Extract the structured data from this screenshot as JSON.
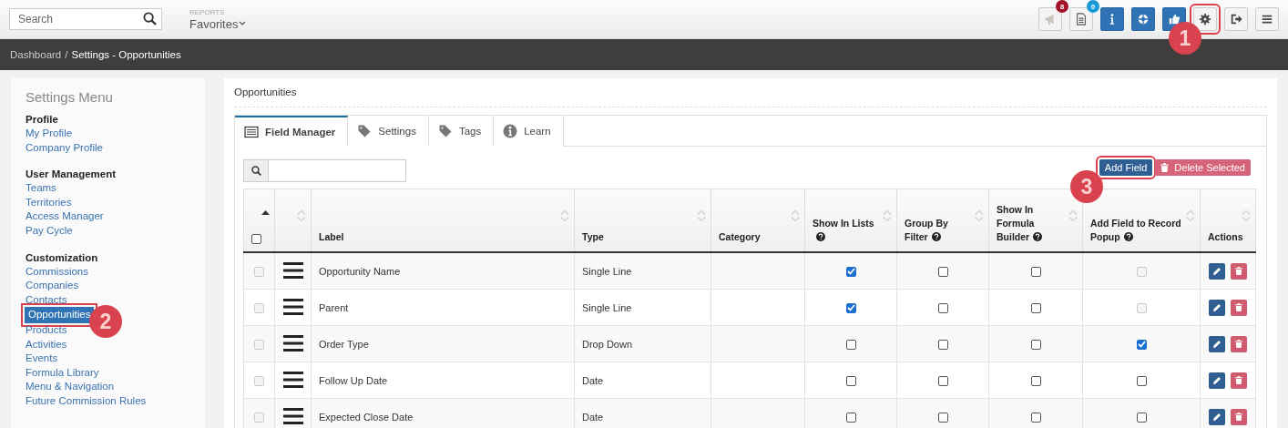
{
  "top_bar": {
    "search": {
      "placeholder": "Search"
    },
    "reports_label": "REPORTS",
    "favorites": "Favorites",
    "toolbar": [
      {
        "kind": "default",
        "badge": {
          "text": "8",
          "color": "#a3142c"
        }
      },
      {
        "kind": "default",
        "badge": {
          "text": "0",
          "color": "#1a9bd7"
        }
      },
      {
        "kind": "primary"
      },
      {
        "kind": "primary"
      },
      {
        "kind": "primary"
      },
      {
        "kind": "default",
        "callout": "1"
      },
      {
        "kind": "default"
      },
      {
        "kind": "default"
      }
    ]
  },
  "breadcrumb": {
    "separator": "/",
    "items": [
      {
        "label": "Dashboard",
        "current": false
      },
      {
        "label": "Settings - Opportunities",
        "current": true
      }
    ]
  },
  "sidebar": {
    "title": "Settings Menu",
    "sections": [
      {
        "heading": "Profile",
        "items": [
          {
            "label": "My Profile",
            "selected": false
          },
          {
            "label": "Company Profile",
            "selected": false
          }
        ]
      },
      {
        "heading": "User Management",
        "items": [
          {
            "label": "Teams",
            "selected": false
          },
          {
            "label": "Territories",
            "selected": false
          },
          {
            "label": "Access Manager",
            "selected": false
          },
          {
            "label": "Pay Cycle",
            "selected": false
          }
        ]
      },
      {
        "heading": "Customization",
        "items": [
          {
            "label": "Commissions",
            "selected": false
          },
          {
            "label": "Companies",
            "selected": false
          },
          {
            "label": "Contacts",
            "selected": false
          },
          {
            "label": "Opportunities",
            "selected": true,
            "callout": "2"
          },
          {
            "label": "Products",
            "selected": false
          },
          {
            "label": "Activities",
            "selected": false
          },
          {
            "label": "Events",
            "selected": false
          },
          {
            "label": "Formula Library",
            "selected": false
          },
          {
            "label": "Menu & Navigation",
            "selected": false
          },
          {
            "label": "Future Commission Rules",
            "selected": false
          }
        ]
      }
    ]
  },
  "panel": {
    "title": "Opportunities",
    "tabs": [
      {
        "label": "Field Manager",
        "selected": true
      },
      {
        "label": "Settings",
        "selected": false
      },
      {
        "label": "Tags",
        "selected": false
      },
      {
        "label": "Learn",
        "selected": false
      }
    ],
    "buttons": [
      {
        "label": "Add Field",
        "kind": "primary",
        "callout": "3"
      },
      {
        "label": "Delete Selected",
        "kind": "danger"
      }
    ],
    "table": {
      "select_all": {
        "checked": false
      },
      "columns": [
        {
          "sorted": true,
          "kind": "select"
        },
        {
          "sorted": false,
          "kind": "drag"
        },
        {
          "label": "Label",
          "sorted": false,
          "help": false
        },
        {
          "label": "Type",
          "sorted": false,
          "help": false
        },
        {
          "label": "Category",
          "sorted": false,
          "help": false
        },
        {
          "label": "Show In Lists",
          "sorted": false,
          "help": true
        },
        {
          "label": "Group By Filter",
          "sorted": false,
          "help": true
        },
        {
          "label": "Show In Formula Builder",
          "sorted": false,
          "help": true
        },
        {
          "label": "Add Field to Record Popup",
          "sorted": false,
          "help": true
        },
        {
          "label": "Actions",
          "sorted": false,
          "help": false
        }
      ],
      "rows": [
        {
          "selected": false,
          "label": "Opportunity Name",
          "type": "Single Line",
          "flags": [
            {
              "checked": true,
              "disabled": false
            },
            {
              "checked": false,
              "disabled": false
            },
            {
              "checked": false,
              "disabled": false
            },
            {
              "checked": false,
              "disabled": true
            }
          ]
        },
        {
          "selected": false,
          "label": "Parent",
          "type": "Single Line",
          "flags": [
            {
              "checked": true,
              "disabled": false
            },
            {
              "checked": false,
              "disabled": false
            },
            {
              "checked": false,
              "disabled": false
            },
            {
              "checked": false,
              "disabled": true
            }
          ]
        },
        {
          "selected": false,
          "label": "Order Type",
          "type": "Drop Down",
          "flags": [
            {
              "checked": false,
              "disabled": false
            },
            {
              "checked": false,
              "disabled": false
            },
            {
              "checked": false,
              "disabled": false
            },
            {
              "checked": true,
              "disabled": false
            }
          ]
        },
        {
          "selected": false,
          "label": "Follow Up Date",
          "type": "Date",
          "flags": [
            {
              "checked": false,
              "disabled": false
            },
            {
              "checked": false,
              "disabled": false
            },
            {
              "checked": false,
              "disabled": false
            },
            {
              "checked": false,
              "disabled": false
            }
          ]
        },
        {
          "selected": false,
          "label": "Expected Close Date",
          "type": "Date",
          "flags": [
            {
              "checked": false,
              "disabled": false
            },
            {
              "checked": false,
              "disabled": false
            },
            {
              "checked": false,
              "disabled": false
            },
            {
              "checked": false,
              "disabled": false
            }
          ]
        }
      ]
    }
  }
}
